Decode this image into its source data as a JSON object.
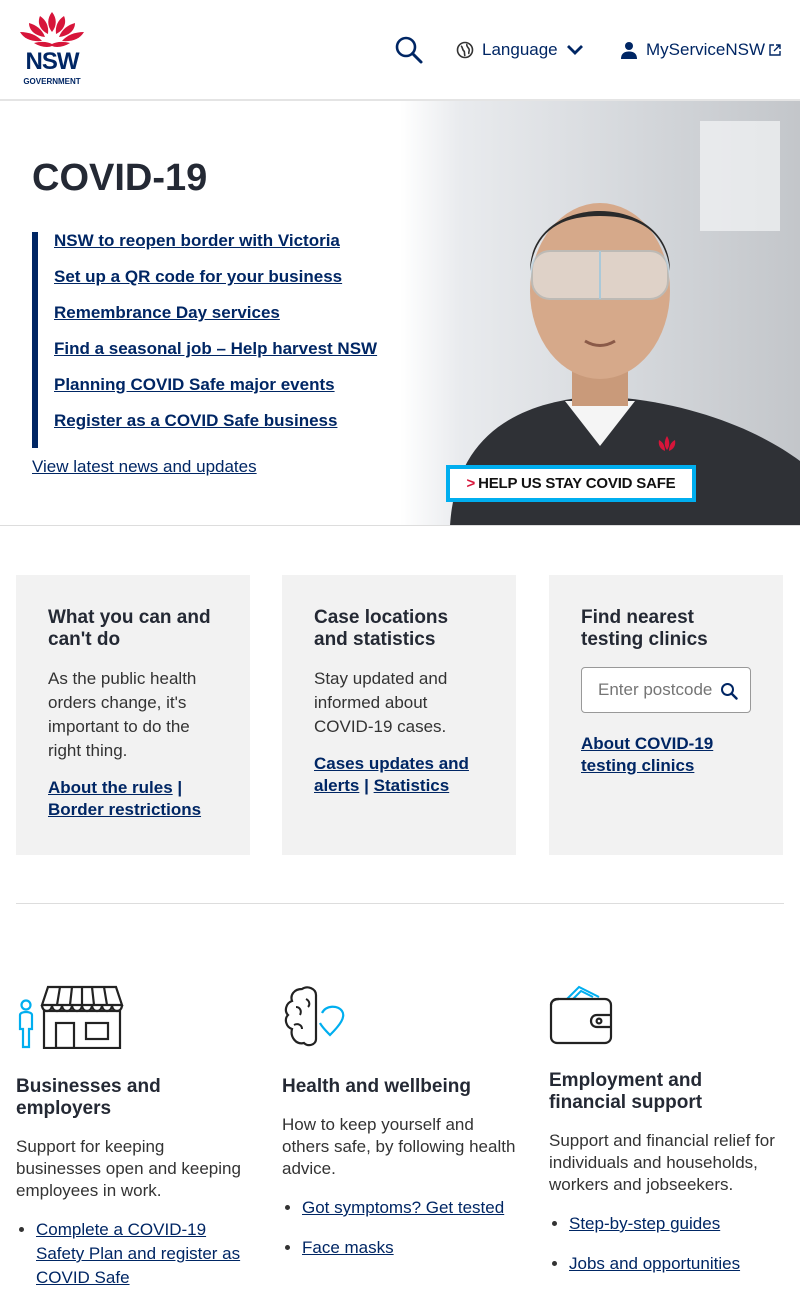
{
  "header": {
    "logo_text": "NSW",
    "logo_sub": "GOVERNMENT",
    "language_label": "Language",
    "myservice_label": "MyServiceNSW"
  },
  "hero": {
    "title": "COVID-19",
    "links": [
      "NSW to reopen border with Victoria",
      "Set up a QR code for your business",
      "Remembrance Day services",
      "Find a seasonal job – Help harvest NSW",
      "Planning COVID Safe major events",
      "Register as a COVID Safe business"
    ],
    "more_link": "View latest news and updates",
    "banner_text": "HELP US STAY COVID SAFE",
    "banner_arrow": ">"
  },
  "cards": [
    {
      "title": "What you can and can't do",
      "text": "As the public health orders change, it's important to do the right thing.",
      "link1": "About the rules",
      "sep": "|",
      "link2": "Border restrictions"
    },
    {
      "title": "Case locations and statistics",
      "text": "Stay updated and informed about COVID-19 cases.",
      "link1": "Cases updates and alerts",
      "sep": "|",
      "link2": "Statistics"
    },
    {
      "title": "Find nearest testing clinics",
      "placeholder": "Enter postcode",
      "link1": "About COVID-19 testing clinics"
    }
  ],
  "topics": [
    {
      "icon": "shop-icon",
      "title": "Businesses and employers",
      "text": "Support for keeping businesses open and keeping employees in work.",
      "links": [
        "Complete a COVID-19 Safety Plan and register as COVID Safe"
      ]
    },
    {
      "icon": "brain-heart-icon",
      "title": "Health and wellbeing",
      "text": "How to keep yourself and others safe, by following health advice.",
      "links": [
        "Got symptoms? Get tested",
        "Face masks"
      ]
    },
    {
      "icon": "wallet-icon",
      "title": "Employment and financial support",
      "text": "Support and financial relief for individuals and households, workers and jobseekers.",
      "links": [
        "Step-by-step guides",
        "Jobs and opportunities"
      ]
    }
  ],
  "colors": {
    "navy": "#002664",
    "red": "#d7153a",
    "light_blue": "#00aeef",
    "card_bg": "#f2f2f2"
  }
}
